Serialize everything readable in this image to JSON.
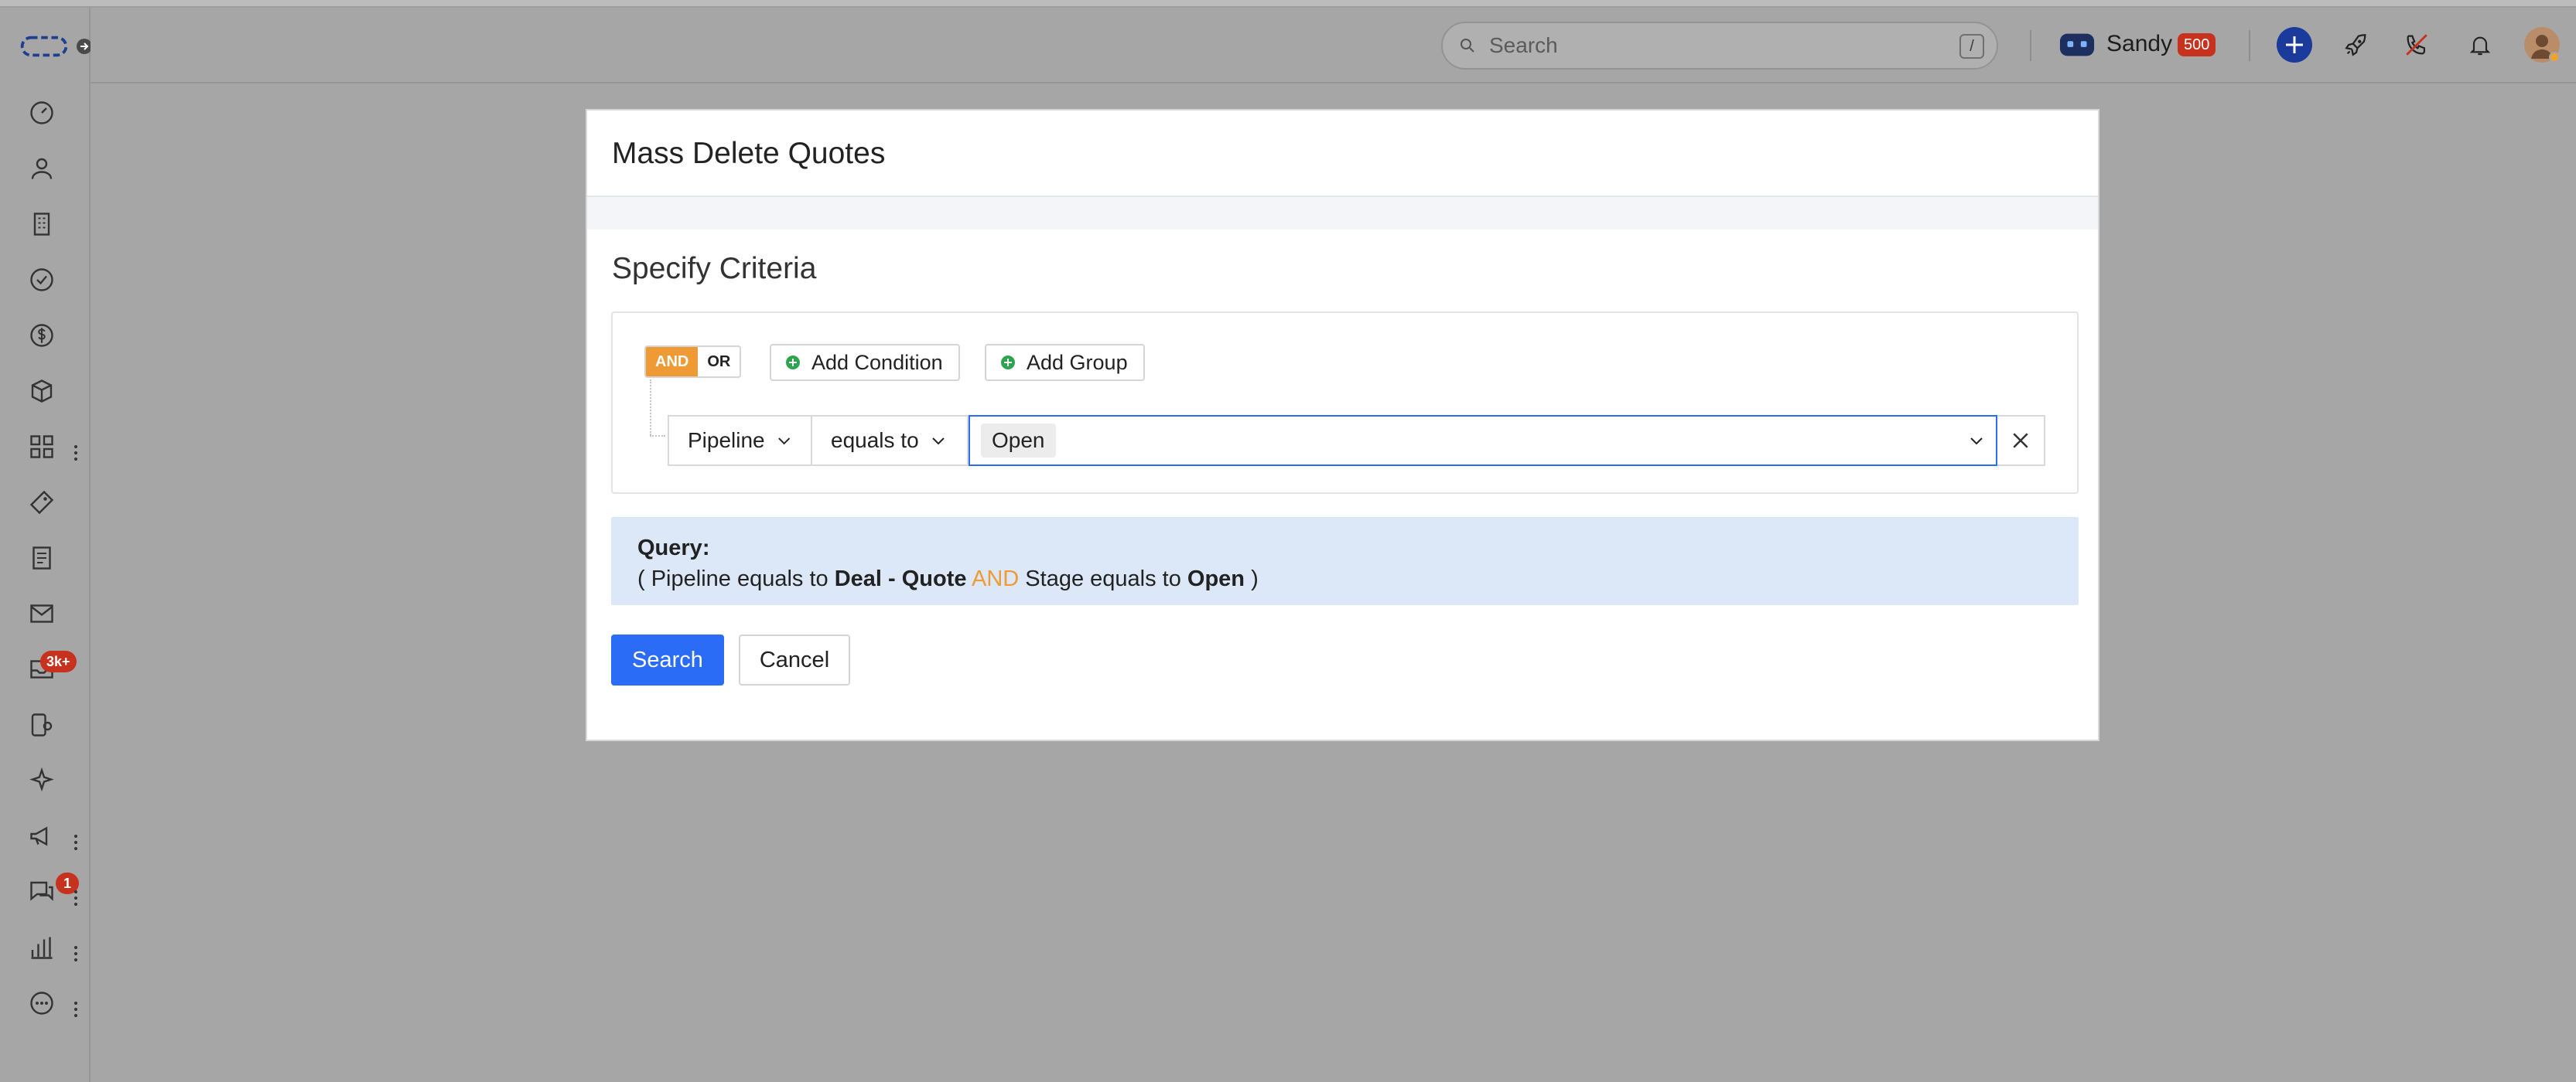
{
  "header": {
    "search_placeholder": "Search",
    "search_shortcut": "/",
    "user_name": "Sandy",
    "credits_badge": "500"
  },
  "sidebar": {
    "inbox_badge": "3k+",
    "chat_badge": "1"
  },
  "modal": {
    "title": "Mass Delete Quotes",
    "section_title": "Specify Criteria",
    "logic": {
      "and_label": "AND",
      "or_label": "OR"
    },
    "add_condition_label": "Add Condition",
    "add_group_label": "Add Group",
    "condition": {
      "field": "Pipeline",
      "operator": "equals to",
      "value_chip": "Open"
    },
    "query": {
      "label": "Query:",
      "open_paren": "( Pipeline equals to ",
      "pipeline_value": "Deal - Quote",
      "connector": "AND",
      "stage_text": " Stage equals to ",
      "stage_value": "Open",
      "close_paren": " )"
    },
    "search_label": "Search",
    "cancel_label": "Cancel"
  },
  "colors": {
    "primary": "#2b6cf6",
    "and_orange": "#ee9a35",
    "badge_red": "#c7321f",
    "query_bg": "#dce8f8",
    "overlay": "#a6a6a7"
  }
}
